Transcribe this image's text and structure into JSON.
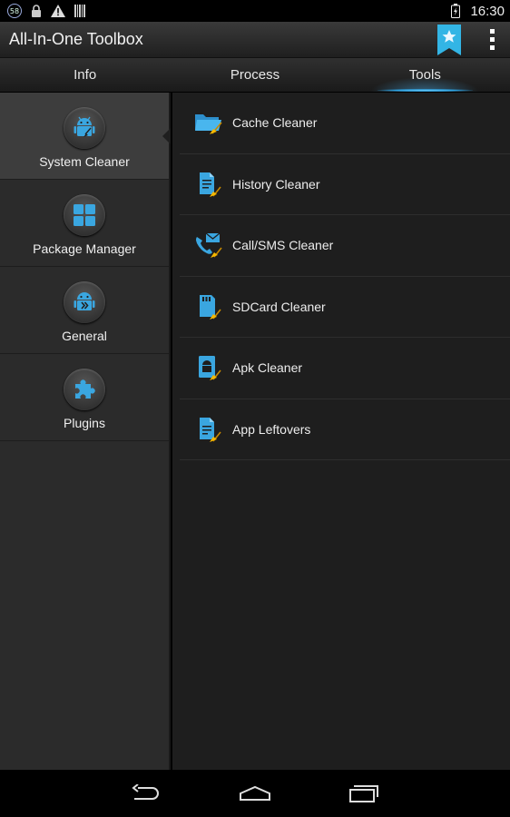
{
  "status_bar": {
    "badge_count": "58",
    "time": "16:30"
  },
  "action_bar": {
    "title": "All-In-One Toolbox"
  },
  "tabs": [
    {
      "label": "Info"
    },
    {
      "label": "Process"
    },
    {
      "label": "Tools"
    }
  ],
  "active_tab": "Tools",
  "sidebar": {
    "items": [
      {
        "label": "System Cleaner",
        "icon": "android-broom-icon"
      },
      {
        "label": "Package Manager",
        "icon": "grid-icon"
      },
      {
        "label": "General",
        "icon": "android-arrows-icon"
      },
      {
        "label": "Plugins",
        "icon": "puzzle-icon"
      }
    ]
  },
  "tools": {
    "items": [
      {
        "label": "Cache Cleaner",
        "icon": "folder-broom-icon"
      },
      {
        "label": "History Cleaner",
        "icon": "document-broom-icon"
      },
      {
        "label": "Call/SMS Cleaner",
        "icon": "phone-mail-broom-icon"
      },
      {
        "label": "SDCard Cleaner",
        "icon": "sdcard-broom-icon"
      },
      {
        "label": "Apk Cleaner",
        "icon": "android-box-broom-icon"
      },
      {
        "label": "App Leftovers",
        "icon": "file-broom-icon"
      }
    ]
  },
  "colors": {
    "accent": "#33b5e5",
    "broom": "#f5b800"
  }
}
